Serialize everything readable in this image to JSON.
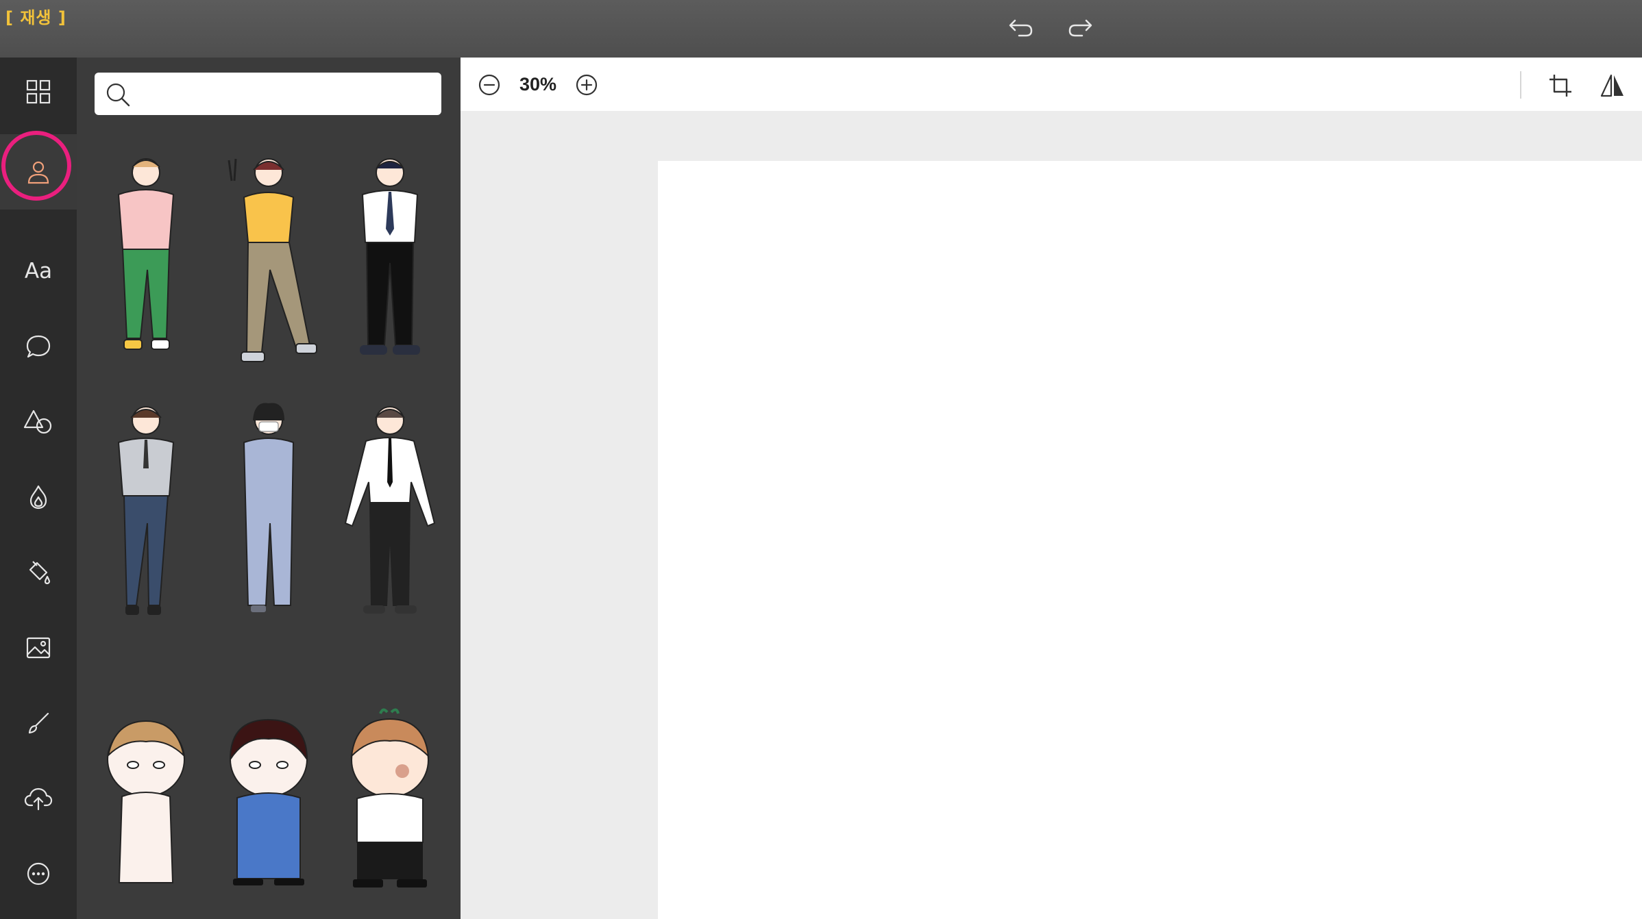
{
  "header": {
    "replay_tag": "[ 재생 ]"
  },
  "rail": {
    "items": [
      {
        "id": "templates",
        "icon": "grid-icon"
      },
      {
        "id": "characters",
        "icon": "person-icon",
        "active": true
      },
      {
        "id": "text",
        "label": "Aa"
      },
      {
        "id": "speech-bubble",
        "icon": "speech-bubble-icon"
      },
      {
        "id": "shapes",
        "icon": "shapes-icon"
      },
      {
        "id": "effects",
        "icon": "flame-icon"
      },
      {
        "id": "background-fill",
        "icon": "paint-bucket-icon"
      },
      {
        "id": "photos",
        "icon": "image-icon"
      },
      {
        "id": "brush",
        "icon": "brush-icon"
      },
      {
        "id": "upload",
        "icon": "cloud-upload-icon"
      },
      {
        "id": "more",
        "icon": "more-icon"
      }
    ],
    "highlight_color": "#ea1f7e"
  },
  "panel": {
    "search": {
      "value": "",
      "placeholder": ""
    },
    "characters": [
      {
        "id": "pink-shirt-man",
        "shirt": "#f7c5c5",
        "pants": "#3c9b57",
        "hair": "#e3b37c"
      },
      {
        "id": "peace-sign-woman",
        "shirt": "#f9c34b",
        "pants": "#a5977a",
        "hair": "#7a2f2f"
      },
      {
        "id": "tie-student",
        "shirt": "#ffffff",
        "pants": "#111111",
        "hair": "#1e2440"
      },
      {
        "id": "gray-uniform-officer",
        "shirt": "#c9ccd2",
        "pants": "#3a4d6b",
        "hair": "#5a3a2a"
      },
      {
        "id": "masked-worker",
        "shirt": "#a9b6d6",
        "pants": "#a9b6d6",
        "hair": "#222222"
      },
      {
        "id": "office-man",
        "shirt": "#ffffff",
        "pants": "#222222",
        "hair": "#5a4a44"
      },
      {
        "id": "chibi-bare",
        "shirt": "#fbf1ec",
        "pants": "#fbf1ec",
        "hair": "#c99b66"
      },
      {
        "id": "chibi-blue",
        "shirt": "#4a78c8",
        "pants": "#4a78c8",
        "hair": "#3b1414"
      },
      {
        "id": "chibi-sprout",
        "shirt": "#ffffff",
        "pants": "#1a1a1a",
        "hair": "#c98a5b"
      }
    ]
  },
  "canvas": {
    "zoom": "30%"
  }
}
